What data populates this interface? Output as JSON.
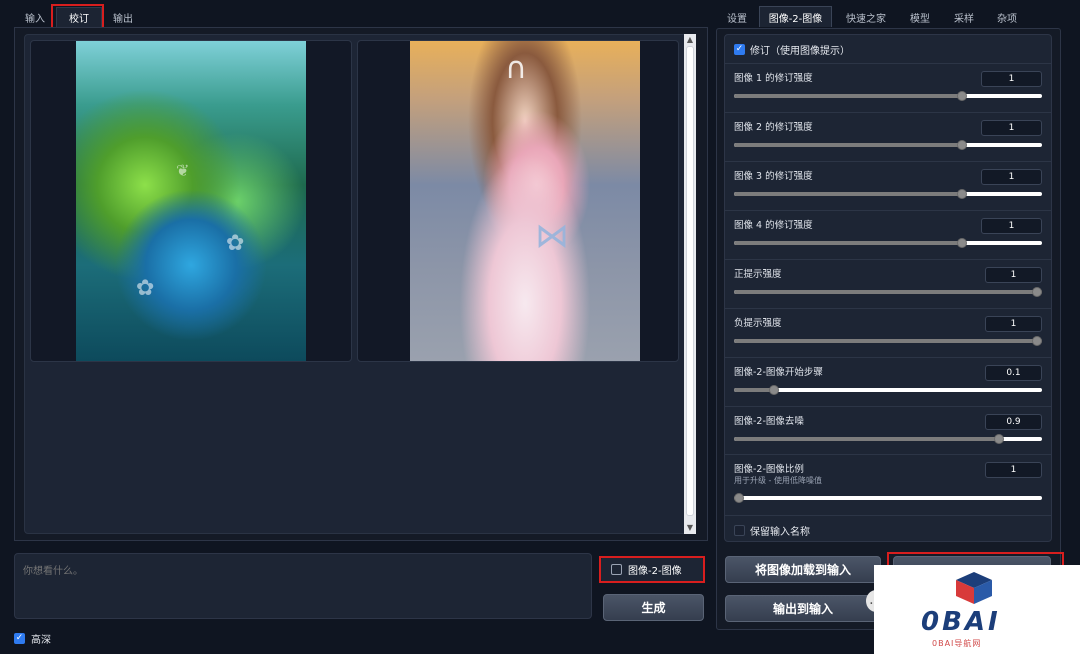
{
  "left_tabs": [
    "输入",
    "校订",
    "输出"
  ],
  "right_tabs": [
    "设置",
    "图像-2-图像",
    "快速之家",
    "模型",
    "采样",
    "杂项"
  ],
  "prompt": {
    "placeholder": "你想看什么。"
  },
  "img2img_checkbox": {
    "label": "图像-2-图像",
    "checked": false
  },
  "generate_label": "生成",
  "hd": {
    "label": "高深",
    "checked": true
  },
  "revision": {
    "label": "修订（使用图像提示）",
    "checked": true
  },
  "sliders": [
    {
      "label": "图像 1 的修订强度",
      "value": "1",
      "level": 0.74
    },
    {
      "label": "图像 2 的修订强度",
      "value": "1",
      "level": 0.74
    },
    {
      "label": "图像 3 的修订强度",
      "value": "1",
      "level": 0.74
    },
    {
      "label": "图像 4 的修订强度",
      "value": "1",
      "level": 0.74
    },
    {
      "label": "正提示强度",
      "value": "1",
      "level": 1.0
    },
    {
      "label": "负提示强度",
      "value": "1",
      "level": 1.0
    },
    {
      "label": "图像-2-图像开始步骤",
      "value": "0.1",
      "level": 0.13
    },
    {
      "label": "图像-2-图像去噪",
      "value": "0.9",
      "level": 0.86
    },
    {
      "label": "图像-2-图像比例",
      "value": "1",
      "level": 0.0,
      "note": "用于升级 - 使用低降噪值"
    }
  ],
  "keep_input_names": {
    "label": "保留输入名称",
    "checked": false
  },
  "buttons": {
    "load_to_input": "将图像加载到输入",
    "output_to_input": "输出到输入"
  },
  "watermark": {
    "title": "0BAI",
    "subtitle": "0BAI导航网"
  },
  "icons": {
    "chat": "chat-bubble-icon",
    "logo": "cube-logo-icon"
  },
  "colors": {
    "accent": "#2f7bf0",
    "highlight": "#d81e1e"
  }
}
